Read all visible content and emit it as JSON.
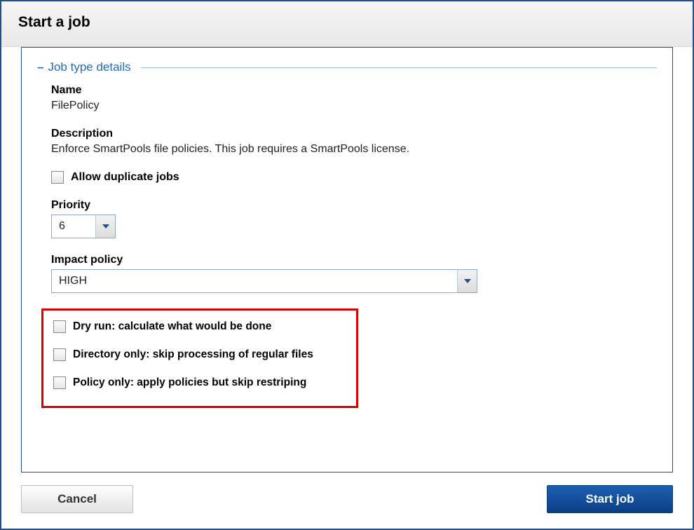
{
  "dialog": {
    "title": "Start a job"
  },
  "section": {
    "legend": "Job type details"
  },
  "fields": {
    "name_label": "Name",
    "name_value": "FilePolicy",
    "description_label": "Description",
    "description_value": "Enforce SmartPools file policies. This job requires a SmartPools license.",
    "allow_duplicate_label": "Allow duplicate jobs",
    "priority_label": "Priority",
    "priority_value": "6",
    "impact_label": "Impact policy",
    "impact_value": "HIGH"
  },
  "options": {
    "dry_run": "Dry run: calculate what would be done",
    "directory_only": "Directory only: skip processing of regular files",
    "policy_only": "Policy only: apply policies but skip restriping"
  },
  "buttons": {
    "cancel": "Cancel",
    "start": "Start job"
  }
}
